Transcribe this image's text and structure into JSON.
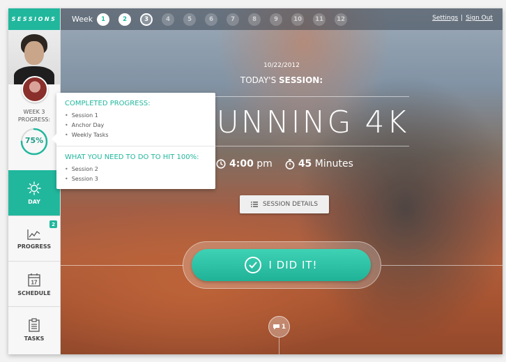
{
  "brand": "SESSIONS",
  "topbar": {
    "week_label": "Week",
    "weeks": [
      {
        "n": "1",
        "state": "done"
      },
      {
        "n": "2",
        "state": "done"
      },
      {
        "n": "3",
        "state": "current"
      },
      {
        "n": "4",
        "state": "todo"
      },
      {
        "n": "5",
        "state": "todo"
      },
      {
        "n": "6",
        "state": "todo"
      },
      {
        "n": "7",
        "state": "todo"
      },
      {
        "n": "8",
        "state": "todo"
      },
      {
        "n": "9",
        "state": "todo"
      },
      {
        "n": "10",
        "state": "todo"
      },
      {
        "n": "11",
        "state": "todo"
      },
      {
        "n": "12",
        "state": "todo"
      }
    ],
    "settings_label": "Settings",
    "separator": "|",
    "signout_label": "Sign Out"
  },
  "sidebar": {
    "week_progress_line1": "WEEK 3",
    "week_progress_line2": "PROGRESS:",
    "progress_percent": "75%",
    "progress_fraction": 0.75,
    "nav": [
      {
        "label": "DAY",
        "icon": "sun-icon",
        "active": true
      },
      {
        "label": "PROGRESS",
        "icon": "chart-icon",
        "badge": "2"
      },
      {
        "label": "SCHEDULE",
        "icon": "calendar-icon",
        "calendar_day": "17"
      },
      {
        "label": "TASKS",
        "icon": "clipboard-icon"
      }
    ]
  },
  "tooltip": {
    "completed_heading": "COMPLETED PROGRESS:",
    "completed_items": [
      "Session 1",
      "Anchor Day",
      "Weekly Tasks"
    ],
    "todo_heading": "WHAT YOU NEED TO DO TO HIT 100%:",
    "todo_items": [
      "Session 2",
      "Session 3"
    ]
  },
  "session": {
    "date": "10/22/2012",
    "today_prefix": "TODAY'S ",
    "today_bold": "SESSION:",
    "title": "RUNNING 4K",
    "time_value": "4:00",
    "time_suffix": " pm",
    "duration_value": "45",
    "duration_suffix": " Minutes",
    "details_button": "SESSION DETAILS",
    "did_it_button": "I DID IT!",
    "comment_count": "1"
  },
  "colors": {
    "accent": "#21b79d"
  }
}
